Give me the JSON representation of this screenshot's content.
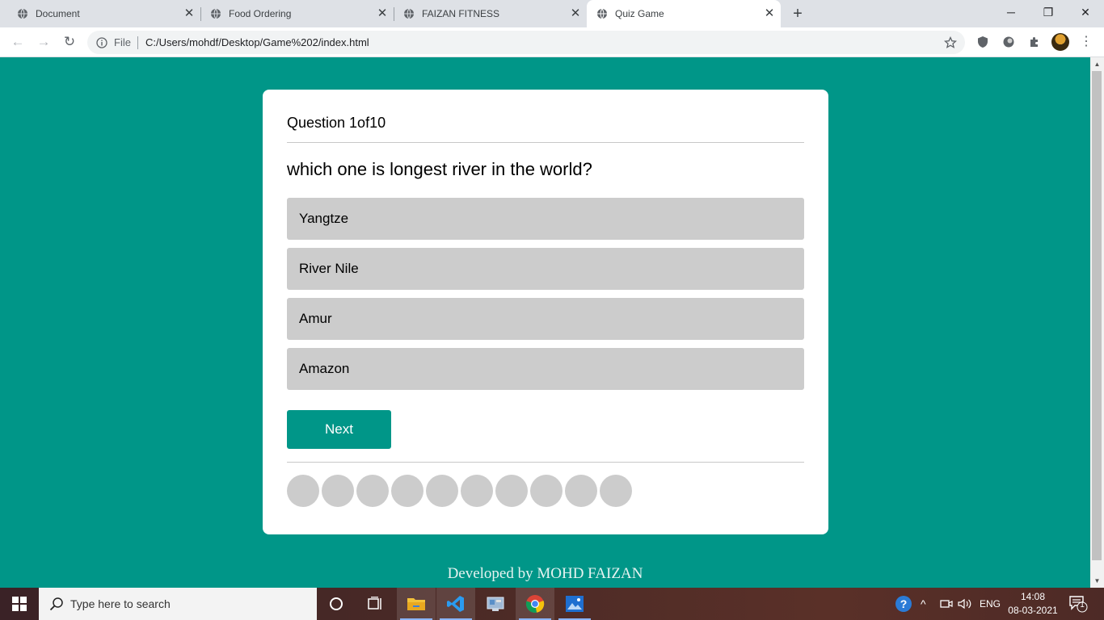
{
  "browser": {
    "tabs": [
      {
        "title": "Document",
        "active": false
      },
      {
        "title": "Food Ordering",
        "active": false
      },
      {
        "title": "FAIZAN FITNESS",
        "active": false
      },
      {
        "title": "Quiz Game",
        "active": true
      }
    ],
    "address": {
      "scheme_label": "File",
      "url": "C:/Users/mohdf/Desktop/Game%202/index.html"
    }
  },
  "quiz": {
    "question_number": "Question 1of10",
    "question": "which one is longest river in the world?",
    "options": [
      "Yangtze",
      "River Nile",
      "Amur",
      "Amazon"
    ],
    "next_label": "Next",
    "progress_total": 10,
    "progress_answered": 0
  },
  "footer": {
    "credit": "Developed by MOHD FAIZAN"
  },
  "taskbar": {
    "search_placeholder": "Type here to search",
    "language": "ENG",
    "time": "14:08",
    "date": "08-03-2021",
    "notification_count": "1"
  },
  "colors": {
    "page_background": "#009688",
    "option_background": "#cccccc",
    "next_button": "#009688",
    "progress_dot": "#cccccc"
  }
}
